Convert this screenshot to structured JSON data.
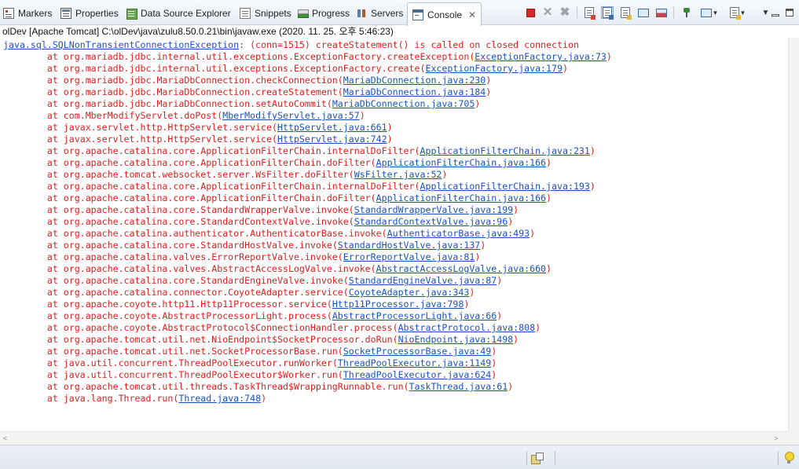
{
  "tabs": [
    {
      "label": "Markers",
      "icon": "markers-icon"
    },
    {
      "label": "Properties",
      "icon": "properties-icon"
    },
    {
      "label": "Data Source Explorer",
      "icon": "data-source-explorer-icon"
    },
    {
      "label": "Snippets",
      "icon": "snippets-icon"
    },
    {
      "label": "Progress",
      "icon": "progress-icon"
    },
    {
      "label": "Servers",
      "icon": "servers-icon"
    },
    {
      "label": "Console",
      "icon": "console-icon",
      "active": true,
      "close": "✕"
    }
  ],
  "toolbar": {
    "icons": [
      "terminate-icon",
      "remove-launch-icon",
      "remove-all-terminated-icon",
      "clear-console-icon",
      "scroll-lock-icon",
      "word-wrap-icon",
      "show-console-on-stdout-icon",
      "show-console-on-stderr-icon",
      "pin-console-icon",
      "display-selected-console-icon",
      "open-console-icon",
      "view-menu-icon"
    ]
  },
  "process_title": "olDev [Apache Tomcat] C:\\olDev\\java\\zulu8.50.0.21\\bin\\javaw.exe (2020. 11. 25. 오후 5:46:23)",
  "console": {
    "exception_class": "java.sql.SQLNonTransientConnectionException",
    "exception_message": ": (conn=1515) createStatement() is called on closed connection",
    "frames": [
      {
        "method": "org.mariadb.jdbc.internal.util.exceptions.ExceptionFactory.createException",
        "location": "ExceptionFactory.java:73"
      },
      {
        "method": "org.mariadb.jdbc.internal.util.exceptions.ExceptionFactory.create",
        "location": "ExceptionFactory.java:179"
      },
      {
        "method": "org.mariadb.jdbc.MariaDbConnection.checkConnection",
        "location": "MariaDbConnection.java:230"
      },
      {
        "method": "org.mariadb.jdbc.MariaDbConnection.createStatement",
        "location": "MariaDbConnection.java:184"
      },
      {
        "method": "org.mariadb.jdbc.MariaDbConnection.setAutoCommit",
        "location": "MariaDbConnection.java:705"
      },
      {
        "method": "com.MberModifyServlet.doPost",
        "location": "MberModifyServlet.java:57"
      },
      {
        "method": "javax.servlet.http.HttpServlet.service",
        "location": "HttpServlet.java:661"
      },
      {
        "method": "javax.servlet.http.HttpServlet.service",
        "location": "HttpServlet.java:742"
      },
      {
        "method": "org.apache.catalina.core.ApplicationFilterChain.internalDoFilter",
        "location": "ApplicationFilterChain.java:231"
      },
      {
        "method": "org.apache.catalina.core.ApplicationFilterChain.doFilter",
        "location": "ApplicationFilterChain.java:166"
      },
      {
        "method": "org.apache.tomcat.websocket.server.WsFilter.doFilter",
        "location": "WsFilter.java:52"
      },
      {
        "method": "org.apache.catalina.core.ApplicationFilterChain.internalDoFilter",
        "location": "ApplicationFilterChain.java:193"
      },
      {
        "method": "org.apache.catalina.core.ApplicationFilterChain.doFilter",
        "location": "ApplicationFilterChain.java:166"
      },
      {
        "method": "org.apache.catalina.core.StandardWrapperValve.invoke",
        "location": "StandardWrapperValve.java:199"
      },
      {
        "method": "org.apache.catalina.core.StandardContextValve.invoke",
        "location": "StandardContextValve.java:96"
      },
      {
        "method": "org.apache.catalina.authenticator.AuthenticatorBase.invoke",
        "location": "AuthenticatorBase.java:493"
      },
      {
        "method": "org.apache.catalina.core.StandardHostValve.invoke",
        "location": "StandardHostValve.java:137"
      },
      {
        "method": "org.apache.catalina.valves.ErrorReportValve.invoke",
        "location": "ErrorReportValve.java:81"
      },
      {
        "method": "org.apache.catalina.valves.AbstractAccessLogValve.invoke",
        "location": "AbstractAccessLogValve.java:660"
      },
      {
        "method": "org.apache.catalina.core.StandardEngineValve.invoke",
        "location": "StandardEngineValve.java:87"
      },
      {
        "method": "org.apache.catalina.connector.CoyoteAdapter.service",
        "location": "CoyoteAdapter.java:343"
      },
      {
        "method": "org.apache.coyote.http11.Http11Processor.service",
        "location": "Http11Processor.java:798"
      },
      {
        "method": "org.apache.coyote.AbstractProcessorLight.process",
        "location": "AbstractProcessorLight.java:66"
      },
      {
        "method": "org.apache.coyote.AbstractProtocol$ConnectionHandler.process",
        "location": "AbstractProtocol.java:808"
      },
      {
        "method": "org.apache.tomcat.util.net.NioEndpoint$SocketProcessor.doRun",
        "location": "NioEndpoint.java:1498"
      },
      {
        "method": "org.apache.tomcat.util.net.SocketProcessorBase.run",
        "location": "SocketProcessorBase.java:49"
      },
      {
        "method": "java.util.concurrent.ThreadPoolExecutor.runWorker",
        "location": "ThreadPoolExecutor.java:1149"
      },
      {
        "method": "java.util.concurrent.ThreadPoolExecutor$Worker.run",
        "location": "ThreadPoolExecutor.java:624"
      },
      {
        "method": "org.apache.tomcat.util.threads.TaskThread$WrappingRunnable.run",
        "location": "TaskThread.java:61"
      },
      {
        "method": "java.lang.Thread.run",
        "location": "Thread.java:748"
      }
    ]
  },
  "colors": {
    "error_text": "#e21d1d",
    "link_text": "#1a52c2"
  },
  "statusbar": {
    "icons": [
      "status-icon",
      "tip-of-the-day-icon"
    ]
  }
}
